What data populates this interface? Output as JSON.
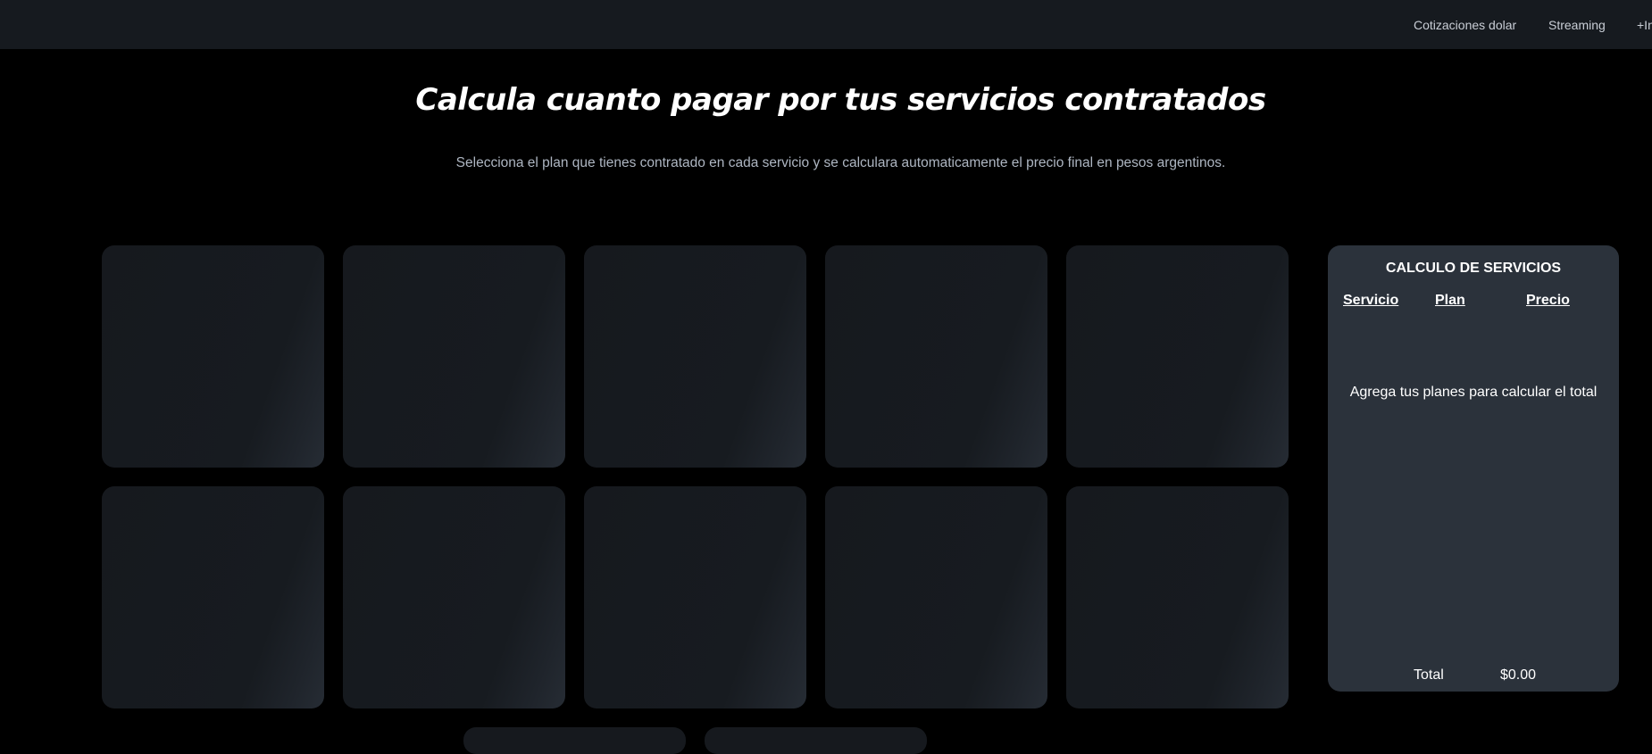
{
  "nav": {
    "items": [
      {
        "label": "Cotizaciones dolar"
      },
      {
        "label": "Streaming"
      },
      {
        "label": "+In"
      }
    ]
  },
  "hero": {
    "title": "Calcula cuanto pagar por tus servicios contratados",
    "subtitle": "Selecciona el plan que tienes contratado en cada servicio y se calculara automaticamente el precio final en pesos argentinos."
  },
  "calculator": {
    "title": "CALCULO DE SERVICIOS",
    "columns": {
      "servicio": "Servicio",
      "plan": "Plan",
      "precio": "Precio"
    },
    "empty_message": "Agrega tus planes para calcular el total",
    "total_label": "Total",
    "total_value": "$0.00"
  }
}
